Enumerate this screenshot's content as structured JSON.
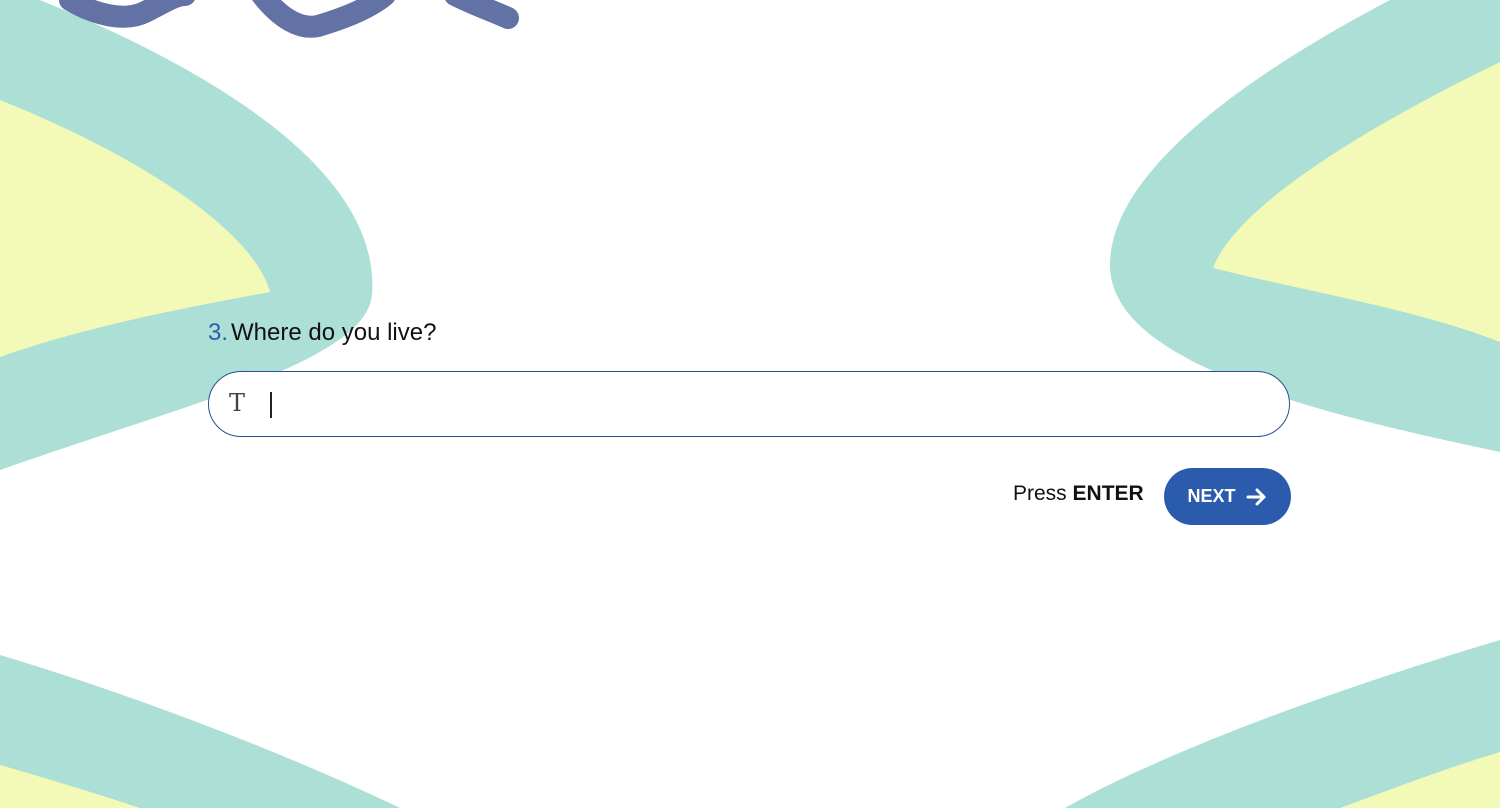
{
  "question": {
    "number": "3.",
    "text": "Where do you live?"
  },
  "answer": {
    "value": "",
    "placeholder": "",
    "icon": "text-type-icon",
    "icon_glyph": "T"
  },
  "hint": {
    "prefix": "Press",
    "key": "ENTER"
  },
  "next_button": {
    "label": "NEXT",
    "icon": "arrow-right-icon"
  },
  "colors": {
    "accent": "#2b5bac",
    "field_border": "#2a4f8f",
    "teal_shape": "#acdfd5",
    "yellow_shape": "#f3fab7",
    "scribble": "#6272a4"
  }
}
